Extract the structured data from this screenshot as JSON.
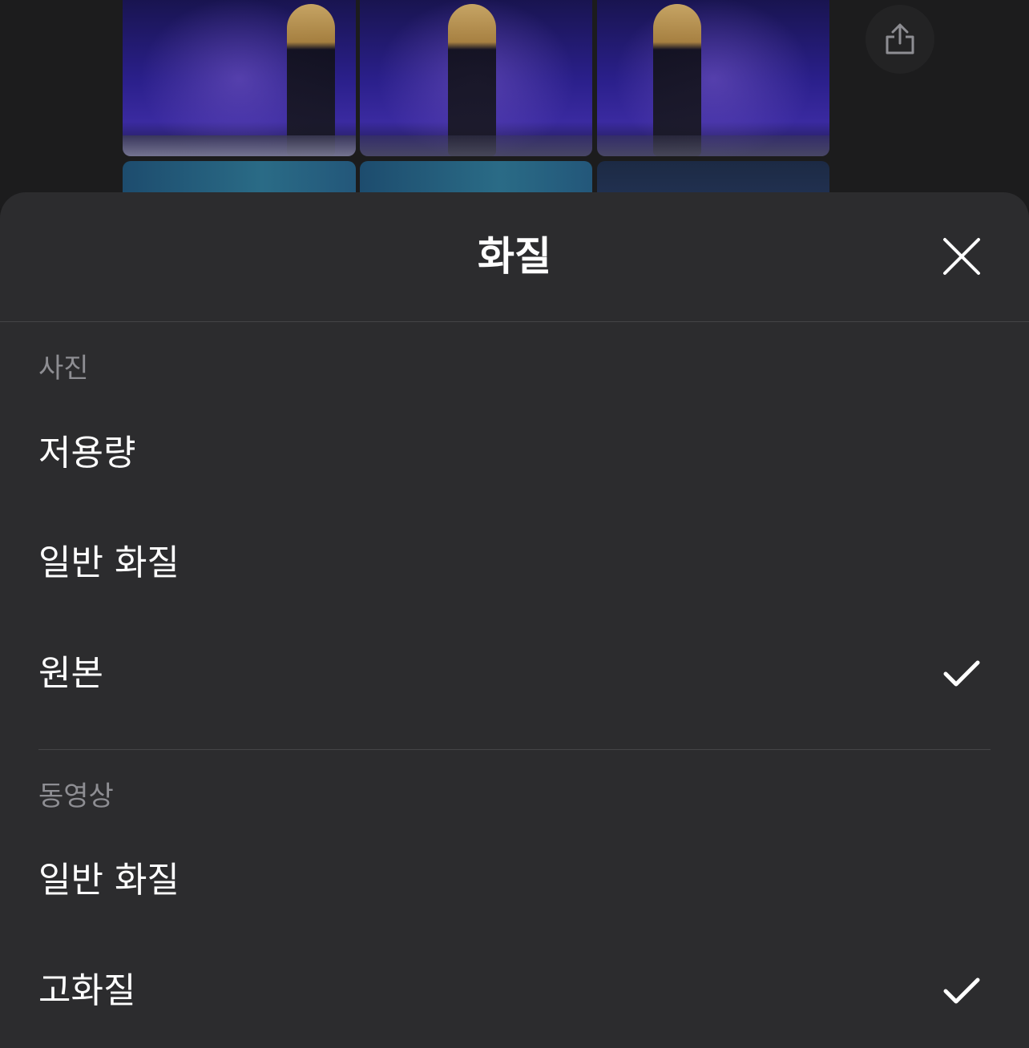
{
  "sheet": {
    "title": "화질",
    "photo_section": {
      "label": "사진",
      "options": [
        {
          "label": "저용량",
          "selected": false
        },
        {
          "label": "일반 화질",
          "selected": false
        },
        {
          "label": "원본",
          "selected": true
        }
      ]
    },
    "video_section": {
      "label": "동영상",
      "options": [
        {
          "label": "일반 화질",
          "selected": false
        },
        {
          "label": "고화질",
          "selected": true
        }
      ]
    }
  },
  "icons": {
    "share": "share-icon",
    "close": "close-icon",
    "check": "checkmark-icon"
  },
  "colors": {
    "sheet_background": "#2c2c2e",
    "section_label": "#8e8e93",
    "text": "#ffffff"
  }
}
